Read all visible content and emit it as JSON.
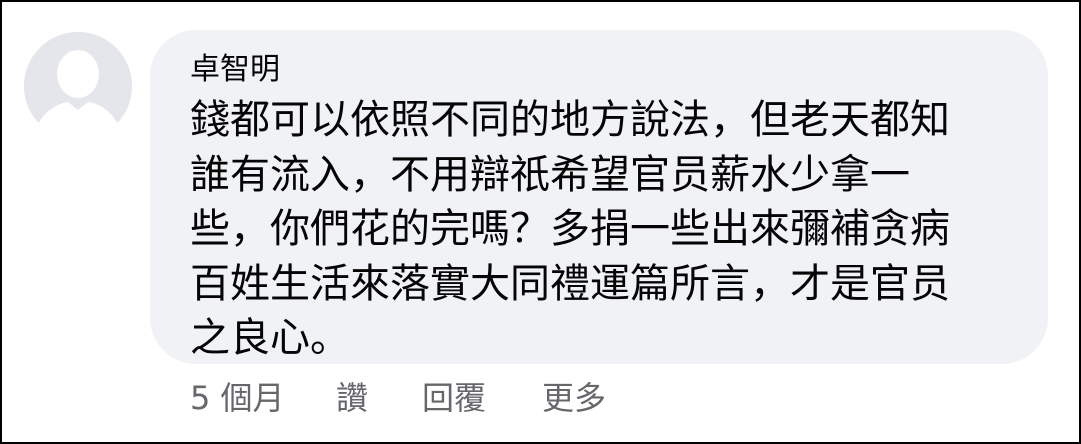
{
  "comment": {
    "author": "卓智明",
    "lines": [
      "錢都可以依照不同的地方說法，但老天都知",
      "誰有流入，不用辯祇希望官员薪水少拿一",
      "些，你們花的完嗎？多捐一些出來彌補贪病",
      "百姓生活來落實大同禮運篇所言，才是官员",
      "之良心。"
    ],
    "avatar_icon": "default-person-silhouette-icon",
    "bubble_color": "#f0f2f5",
    "text_color": "#050505"
  },
  "actions": {
    "time": "5 個月",
    "like": "讚",
    "reply": "回覆",
    "more": "更多",
    "color": "#65676b"
  }
}
